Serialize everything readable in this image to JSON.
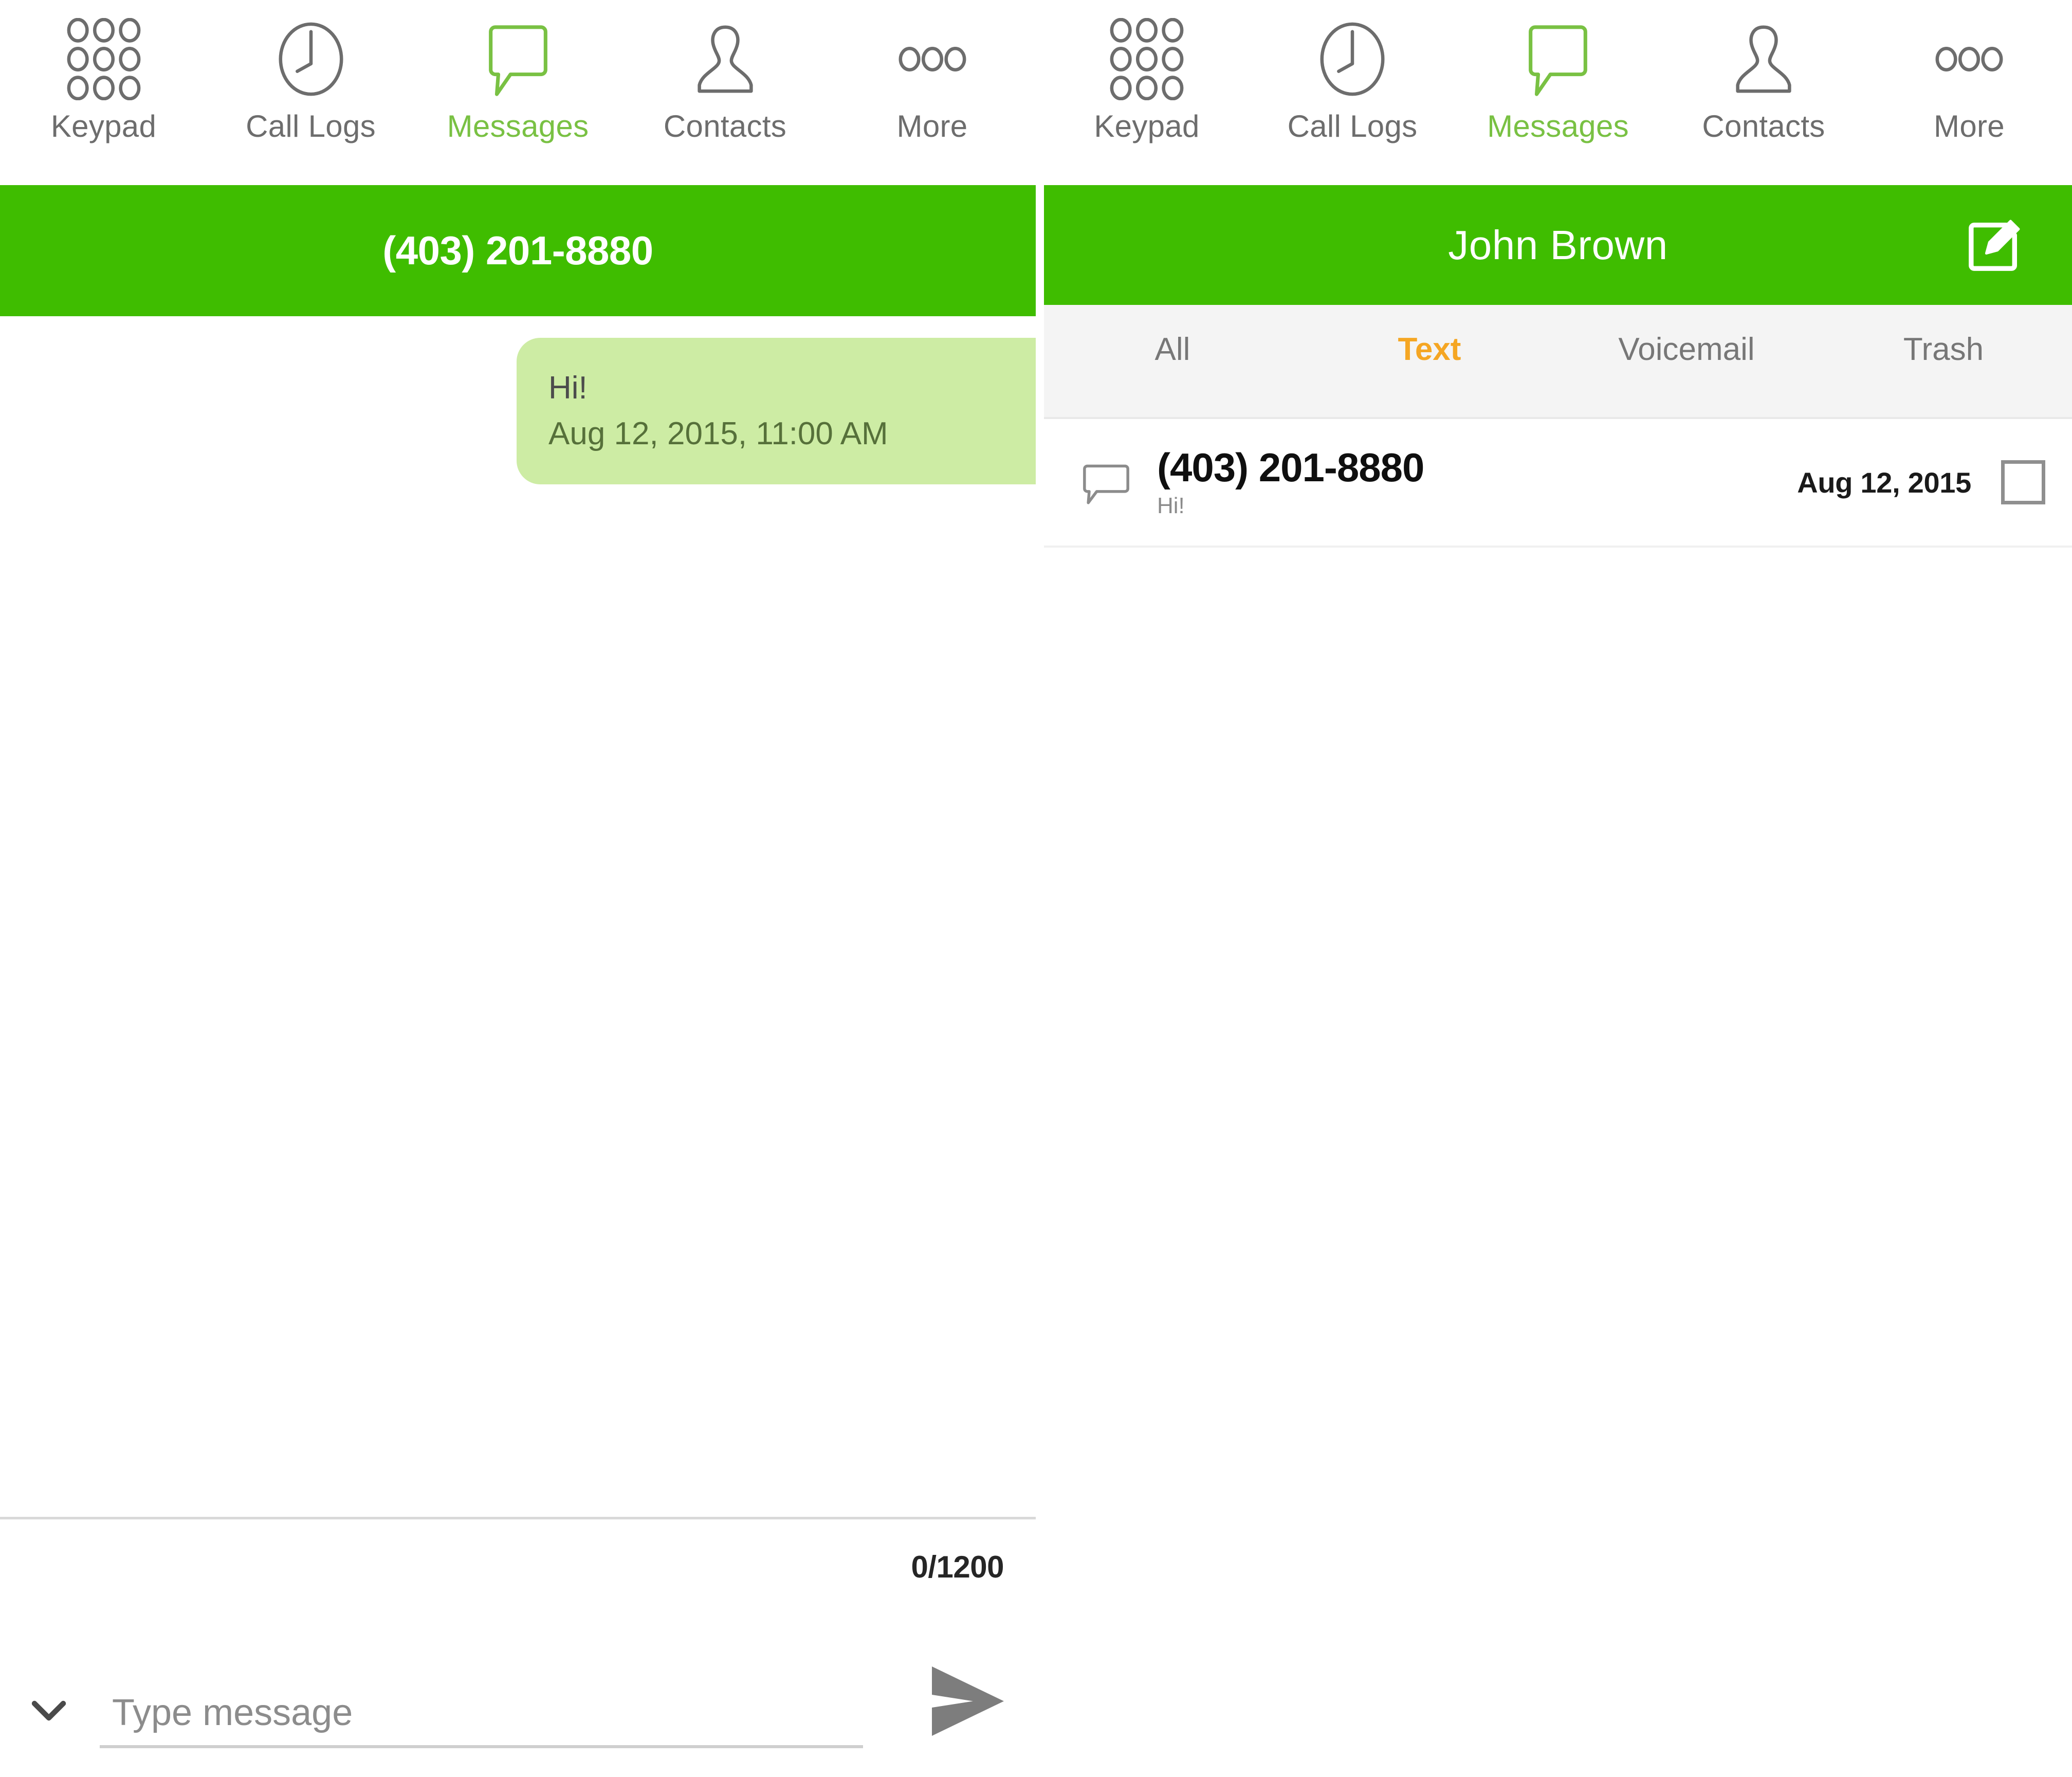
{
  "colors": {
    "brand_green": "#3fbd00",
    "accent_green": "#79c143",
    "bubble_green": "#cdeca4",
    "active_tab_orange": "#f5a623",
    "icon_gray": "#6d6d6d"
  },
  "topnav": {
    "items": [
      {
        "label": "Keypad",
        "icon": "keypad-icon",
        "active": false
      },
      {
        "label": "Call Logs",
        "icon": "clock-icon",
        "active": false
      },
      {
        "label": "Messages",
        "icon": "message-bubble-icon",
        "active": true
      },
      {
        "label": "Contacts",
        "icon": "person-icon",
        "active": false
      },
      {
        "label": "More",
        "icon": "ellipsis-icon",
        "active": false
      }
    ]
  },
  "left_panel": {
    "title": "(403) 201-8880",
    "conversation": {
      "messages": [
        {
          "text": "Hi!",
          "timestamp": "Aug 12, 2015, 11:00 AM",
          "direction": "outgoing"
        }
      ]
    },
    "composer": {
      "char_counter": "0/1200",
      "input_value": "",
      "input_placeholder": "Type message",
      "expand_icon": "chevron-down-icon",
      "send_icon": "send-arrow-icon"
    }
  },
  "right_panel": {
    "title": "John Brown",
    "compose_icon": "compose-edit-icon",
    "filter_tabs": [
      {
        "label": "All",
        "active": false
      },
      {
        "label": "Text",
        "active": true
      },
      {
        "label": "Voicemail",
        "active": false
      },
      {
        "label": "Trash",
        "active": false
      }
    ],
    "message_list": [
      {
        "icon": "message-bubble-outline-icon",
        "title": "(403) 201-8880",
        "snippet": "Hi!",
        "date": "Aug 12, 2015",
        "checked": false
      }
    ]
  }
}
